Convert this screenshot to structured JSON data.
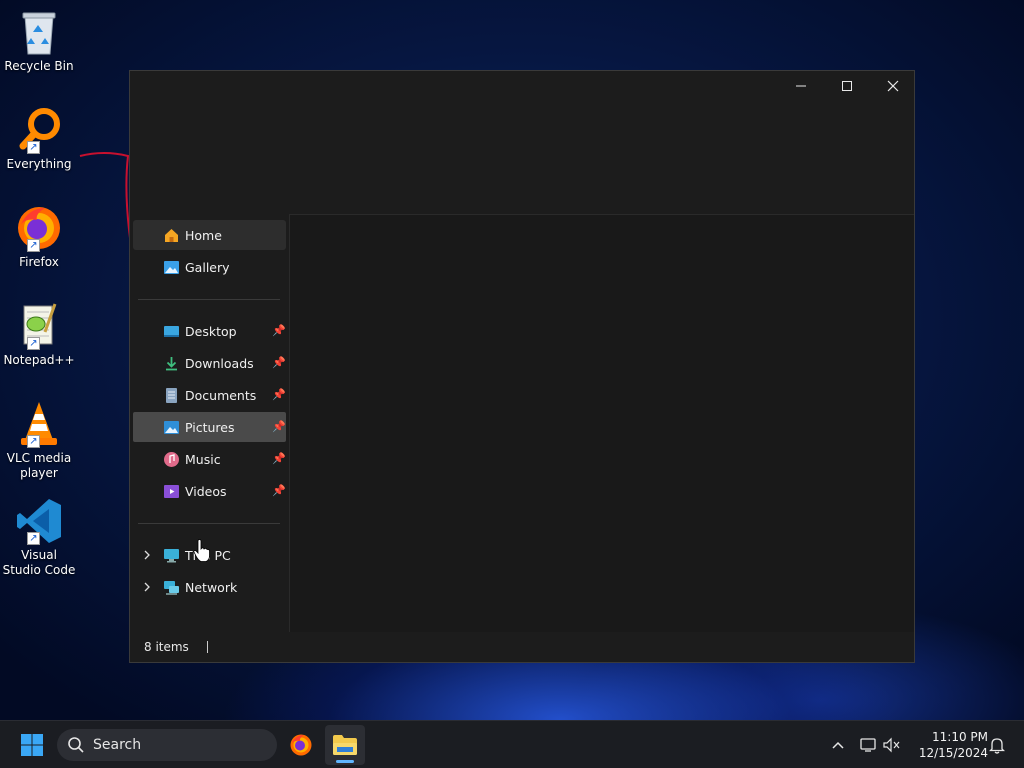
{
  "desktop": {
    "icons": [
      {
        "label": "Recycle Bin",
        "name": "recycle-bin-icon"
      },
      {
        "label": "Everything",
        "name": "everything-icon"
      },
      {
        "label": "Firefox",
        "name": "firefox-icon"
      },
      {
        "label": "Notepad++",
        "name": "notepad-plus-plus-icon"
      },
      {
        "label": "VLC media player",
        "name": "vlc-icon"
      },
      {
        "label": "Visual Studio Code",
        "name": "vscode-icon"
      }
    ]
  },
  "explorer": {
    "nav": {
      "home": "Home",
      "gallery": "Gallery",
      "desktop": "Desktop",
      "downloads": "Downloads",
      "documents": "Documents",
      "pictures": "Pictures",
      "music": "Music",
      "videos": "Videos",
      "this_pc": "This PC",
      "network": "Network"
    },
    "status": "8 items"
  },
  "taskbar": {
    "search_placeholder": "Search",
    "time": "11:10 PM",
    "date": "12/15/2024"
  },
  "colors": {
    "accent": "#60b6ff",
    "window_bg": "#1c1c1c",
    "taskbar_bg": "#1b1d22"
  }
}
